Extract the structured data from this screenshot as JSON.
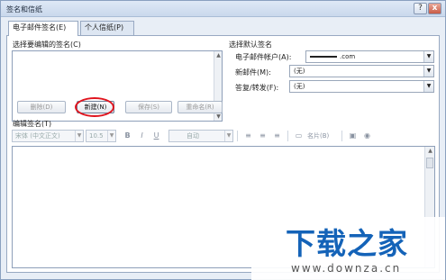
{
  "window": {
    "title": "签名和信纸",
    "help": "?",
    "close": "x"
  },
  "tabs": [
    {
      "label": "电子邮件签名(E)"
    },
    {
      "label": "个人信纸(P)"
    }
  ],
  "signature_list": {
    "label": "选择要编辑的签名(C)"
  },
  "buttons": {
    "delete": "删除(D)",
    "new": "新建(N)",
    "save": "保存(S)",
    "rename": "重命名(R)"
  },
  "defaults": {
    "heading": "选择默认签名",
    "account_label": "电子邮件帐户(A):",
    "account_value": ".com",
    "new_label": "新邮件(M):",
    "new_value": "(无)",
    "reply_label": "答复/转发(F):",
    "reply_value": "(无)"
  },
  "editor": {
    "label": "编辑签名(T)",
    "font": "宋体 (中文正文)",
    "size": "10.5",
    "color": "自动",
    "bold": "B",
    "italic": "I",
    "underline": "U",
    "business_card": "名片(B)"
  },
  "watermark": {
    "main": "下载之家",
    "sub": "www.downza.cn"
  },
  "colors": {
    "highlight": "#e0141e",
    "watermark_blue": "#1463b8"
  }
}
